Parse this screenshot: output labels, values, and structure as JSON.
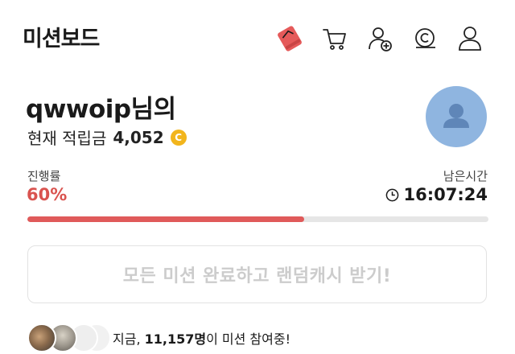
{
  "header": {
    "title": "미션보드",
    "icons": [
      "shoe-icon",
      "cart-icon",
      "add-user-icon",
      "cash-icon",
      "profile-icon"
    ]
  },
  "user": {
    "name": "qwwoip님의",
    "points_label": "현재 적립금",
    "points_value": "4,052",
    "coin_symbol": "C"
  },
  "progress": {
    "label": "진행률",
    "value": "60%",
    "fraction": 0.6
  },
  "timer": {
    "label": "남은시간",
    "value": "16:07:24"
  },
  "reward_button": {
    "label": "모든 미션 완료하고 랜덤캐시 받기!"
  },
  "participants": {
    "prefix": "지금, ",
    "count": "11,157명",
    "suffix": "이 미션 참여중!"
  },
  "colors": {
    "accent_red": "#e05a5a",
    "progress_text": "#d9534f",
    "coin": "#f2b51c",
    "avatar_bg": "#8fb5e0"
  }
}
